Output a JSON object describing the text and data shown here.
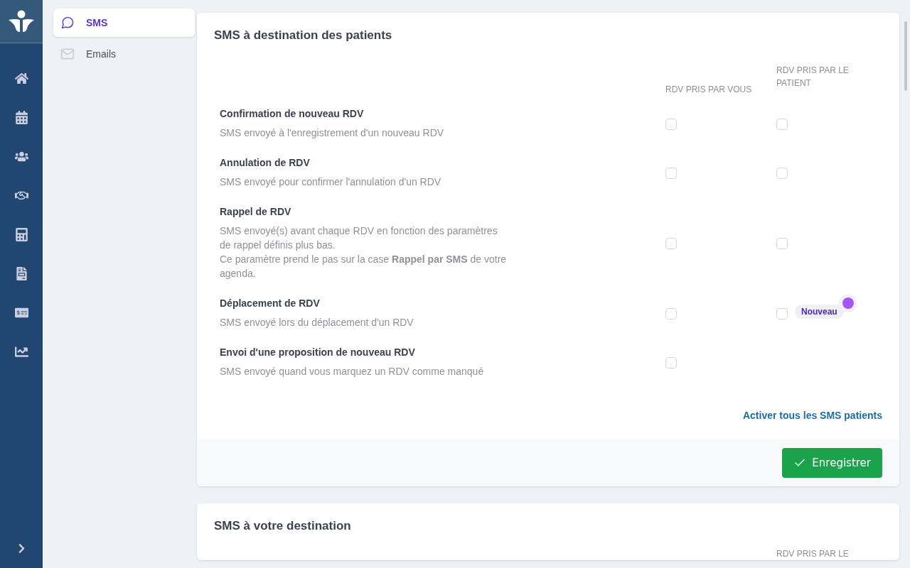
{
  "subnav": {
    "items": [
      {
        "label": "SMS",
        "kind": "sms",
        "selected": true
      },
      {
        "label": "Emails",
        "kind": "email",
        "selected": false
      }
    ]
  },
  "patient_sms": {
    "title": "SMS à destination des patients",
    "columns": [
      "RDV PRIS PAR VOUS",
      "RDV PRIS PAR LE PATIENT"
    ],
    "rows": [
      {
        "title": "Confirmation de nouveau RDV",
        "description": [
          "SMS envoyé à l'enregistrement d'un nouveau RDV"
        ],
        "by_you": {
          "checked": false
        },
        "by_patient": {
          "checked": false
        }
      },
      {
        "title": "Annulation de RDV",
        "description": [
          "SMS envoyé pour confirmer l'annulation d'un RDV"
        ],
        "by_you": {
          "checked": false
        },
        "by_patient": {
          "checked": false
        }
      },
      {
        "title": "Rappel de RDV",
        "description": [
          "SMS envoyé(s) avant chaque RDV en fonction des paramètres de rappel définis plus bas.",
          "Ce paramètre prend le pas sur la case **Rappel par SMS** de votre agenda."
        ],
        "by_you": {
          "checked": false
        },
        "by_patient": {
          "checked": false
        }
      },
      {
        "title": "Déplacement de RDV",
        "description": [
          "SMS envoyé lors du déplacement d'un RDV"
        ],
        "by_you": {
          "checked": false
        },
        "by_patient": {
          "checked": false
        },
        "badge": {
          "label": "Nouveau",
          "dot": true
        }
      },
      {
        "title": "Envoi d'une proposition de nouveau RDV",
        "description": [
          "SMS envoyé quand vous marquez un RDV comme manqué"
        ],
        "by_you": {
          "checked": false
        }
      }
    ],
    "link": "Activer tous les SMS patients",
    "save_button": "Enregistrer"
  },
  "own_sms": {
    "title": "SMS à votre destination",
    "columns": [
      "",
      "RDV PRIS PAR LE"
    ]
  }
}
